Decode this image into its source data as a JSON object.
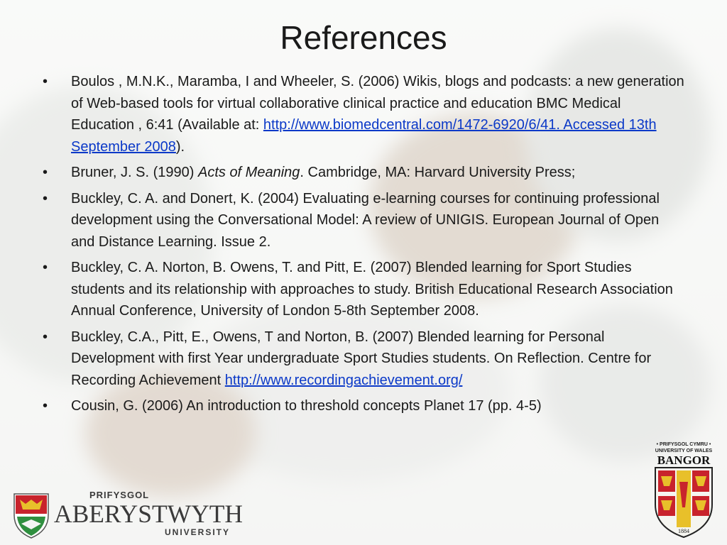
{
  "slide": {
    "title": "References",
    "references": [
      {
        "bullet": "•",
        "text_before": "Boulos , M.N.K., Maramba, I  and Wheeler, S. (2006) Wikis, blogs and podcasts: a new generation of Web-based tools for virtual collaborative clinical practice and education  BMC Medical Education , 6:41 (Available at: ",
        "link_text": "http://www.biomedcentral.com/1472-6920/6/41. Accessed 13th September 2008",
        "text_after": ")."
      },
      {
        "bullet": "•",
        "text_before": "Bruner, J. S.  (1990) ",
        "italic_text": "Acts of Meaning",
        "text_after": ". Cambridge, MA: Harvard University Press;"
      },
      {
        "bullet": "•",
        "text": "Buckley, C. A. and Donert, K. (2004) Evaluating e-learning courses for continuing professional development using the Conversational Model: A review of UNIGIS. European Journal of Open and Distance Learning. Issue 2."
      },
      {
        "bullet": "•",
        "text": "Buckley, C. A. Norton, B. Owens, T. and Pitt, E. (2007) Blended learning for Sport Studies students and its relationship with approaches to study. British Educational Research Association Annual Conference, University of London 5-8th September 2008."
      },
      {
        "bullet": "•",
        "text_before": "Buckley, C.A., Pitt, E., Owens, T and Norton, B. (2007) Blended learning for Personal Development with first Year undergraduate Sport Studies students. On Reflection. Centre for Recording Achievement ",
        "link_text": "http://www.recordingachievement.org/"
      },
      {
        "bullet": "•",
        "text": "Cousin, G. (2006) An introduction to threshold concepts Planet 17 (pp. 4-5)"
      }
    ],
    "logo_aberystwyth": {
      "line1": "PRIFYSGOL",
      "line2": "ABERYSTWYTH",
      "line3": "UNIVERSITY"
    },
    "logo_bangor": {
      "line1": "• PRIFYSGOL CYMRU •",
      "line2": "UNIVERSITY OF WALES",
      "line3": "BANGOR",
      "year": "1884"
    },
    "colors": {
      "text": "#1a1a1a",
      "link": "#0b39c8",
      "crest_red": "#c8232c",
      "crest_gold": "#e8c02a"
    }
  }
}
